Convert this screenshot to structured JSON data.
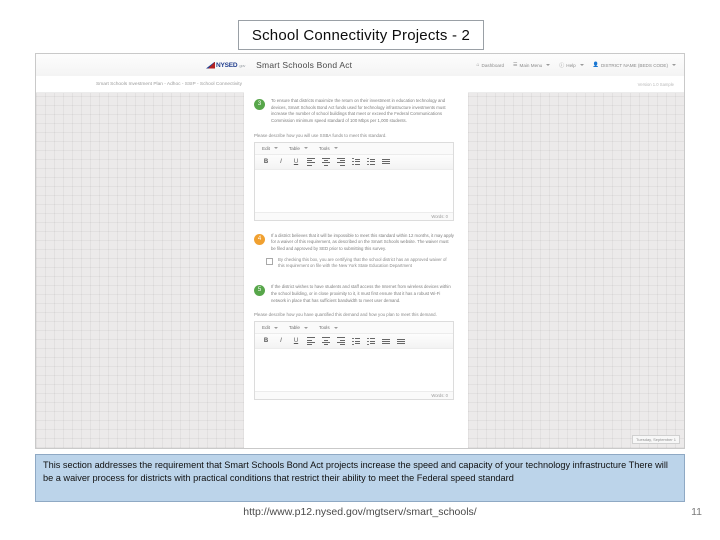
{
  "slide": {
    "title": "School Connectivity Projects - 2",
    "page_number": "11",
    "footer_url": "http://www.p12.nysed.gov/mgtserv/smart_schools/",
    "caption": "This section addresses the requirement that Smart Schools Bond Act projects increase the speed and capacity of your technology infrastructure  There will be a waiver process for districts  with practical conditions that restrict their ability to meet the Federal speed standard",
    "caption_bg": "#bcd4ea",
    "caption_border": "#8fa9c4"
  },
  "app": {
    "logo_text": "NYSED",
    "logo_sub": ".gov",
    "title": "Smart Schools Bond Act",
    "breadcrumb": "Smart Schools Investment Plan - Adhoc - SSIP - School Connectivity",
    "breadcrumb_right": "Version 1.0 Sample",
    "nav": [
      {
        "label": "Dashboard",
        "icon": "home-icon",
        "caret": false
      },
      {
        "label": "Main Menu",
        "icon": "menu-icon",
        "caret": true
      },
      {
        "label": "Help",
        "icon": "help-icon",
        "caret": true
      },
      {
        "label": "DISTRICT NAME (BEDS CODE)",
        "icon": "user-icon",
        "caret": true
      }
    ],
    "date_chip": "Tuesday, September 1"
  },
  "questions": [
    {
      "number": "3",
      "color": "#57a64a",
      "text": "To ensure that districts maximize the return on their investment in education technology and devices, Smart Schools Bond Act funds used for technology infrastructure investments must increase the number of school buildings that meet or exceed the Federal Communications Commission minimum speed standard of 100 Mbps per 1,000 students."
    },
    {
      "number": "4",
      "color": "#f0a030",
      "text": "If a district believes that it will be impossible to meet this standard within 12 months, it may apply for a waiver of this requirement, as described on the Smart Schools website. The waiver must be filed and approved by SED prior to submitting this survey."
    },
    {
      "number": "5",
      "color": "#57a64a",
      "text": "If the district wishes to have students and staff access the Internet from wireless devices within the school building, or in close proximity to it, it must first ensure that it has a robust Wi-Fi network in place that has sufficient bandwidth to meet user demand."
    }
  ],
  "prompts": {
    "first": "Please describe how you will use SSBA funds to meet this standard.",
    "second": "Please describe how you have quantified this demand and how you plan to meet this demand."
  },
  "checkbox": {
    "label": "By checking this box, you are certifying that the school district has an approved waiver of this requirement on file with the New York State Education Department",
    "checked": false
  },
  "editor": {
    "menus": [
      "Edit",
      "Table",
      "Tools"
    ],
    "tools": [
      "bold",
      "italic",
      "underline",
      "align-left",
      "align-center",
      "align-right",
      "bullet-list",
      "number-list",
      "outdent",
      "indent"
    ],
    "word_count": "Words: 0"
  }
}
